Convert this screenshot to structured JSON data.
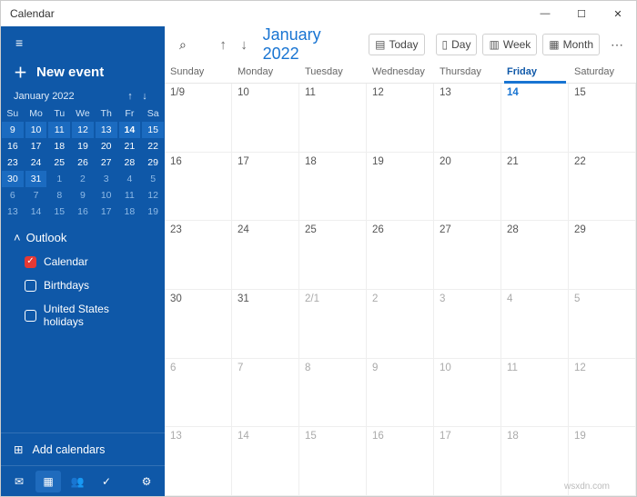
{
  "window": {
    "title": "Calendar"
  },
  "win_controls": {
    "min": "—",
    "max": "☐",
    "close": "✕"
  },
  "sidebar": {
    "hamburger": "≡",
    "new_event": {
      "icon": "＋",
      "label": "New event"
    },
    "mini": {
      "label": "January 2022",
      "up": "↑",
      "down": "↓",
      "dow": [
        "Su",
        "Mo",
        "Tu",
        "We",
        "Th",
        "Fr",
        "Sa"
      ],
      "weeks": [
        [
          {
            "d": "9",
            "c": "selmonth cw"
          },
          {
            "d": "10",
            "c": "selmonth cw"
          },
          {
            "d": "11",
            "c": "selmonth cw"
          },
          {
            "d": "12",
            "c": "selmonth cw"
          },
          {
            "d": "13",
            "c": "selmonth cw"
          },
          {
            "d": "14",
            "c": "selmonth cw today"
          },
          {
            "d": "15",
            "c": "selmonth cw"
          }
        ],
        [
          {
            "d": "16",
            "c": "selmonth"
          },
          {
            "d": "17",
            "c": "selmonth"
          },
          {
            "d": "18",
            "c": "selmonth"
          },
          {
            "d": "19",
            "c": "selmonth"
          },
          {
            "d": "20",
            "c": "selmonth"
          },
          {
            "d": "21",
            "c": "selmonth"
          },
          {
            "d": "22",
            "c": "selmonth"
          }
        ],
        [
          {
            "d": "23",
            "c": "selmonth"
          },
          {
            "d": "24",
            "c": "selmonth"
          },
          {
            "d": "25",
            "c": "selmonth"
          },
          {
            "d": "26",
            "c": "selmonth"
          },
          {
            "d": "27",
            "c": "selmonth"
          },
          {
            "d": "28",
            "c": "selmonth"
          },
          {
            "d": "29",
            "c": "selmonth"
          }
        ],
        [
          {
            "d": "30",
            "c": "selmonth end"
          },
          {
            "d": "31",
            "c": "selmonth end"
          },
          {
            "d": "1",
            "c": "fade"
          },
          {
            "d": "2",
            "c": "fade"
          },
          {
            "d": "3",
            "c": "fade"
          },
          {
            "d": "4",
            "c": "fade"
          },
          {
            "d": "5",
            "c": "fade"
          }
        ],
        [
          {
            "d": "6",
            "c": "fade"
          },
          {
            "d": "7",
            "c": "fade"
          },
          {
            "d": "8",
            "c": "fade"
          },
          {
            "d": "9",
            "c": "fade"
          },
          {
            "d": "10",
            "c": "fade"
          },
          {
            "d": "11",
            "c": "fade"
          },
          {
            "d": "12",
            "c": "fade"
          }
        ],
        [
          {
            "d": "13",
            "c": "fade"
          },
          {
            "d": "14",
            "c": "fade"
          },
          {
            "d": "15",
            "c": "fade"
          },
          {
            "d": "16",
            "c": "fade"
          },
          {
            "d": "17",
            "c": "fade"
          },
          {
            "d": "18",
            "c": "fade"
          },
          {
            "d": "19",
            "c": "fade"
          }
        ]
      ]
    },
    "accounts": {
      "caret": "˄",
      "label": "Outlook",
      "items": [
        {
          "label": "Calendar",
          "checked": true
        },
        {
          "label": "Birthdays",
          "checked": false
        },
        {
          "label": "United States holidays",
          "checked": false
        }
      ]
    },
    "add_cals": {
      "icon": "⊞",
      "label": "Add calendars"
    },
    "bottom_icons": {
      "mail": "✉",
      "calendar": "▦",
      "people": "👥",
      "todo": "✓",
      "settings": "⚙"
    }
  },
  "toolbar": {
    "search": "⌕",
    "up": "↑",
    "down": "↓",
    "current": "January 2022",
    "today": {
      "icon": "▤",
      "label": "Today"
    },
    "day": {
      "icon": "▯",
      "label": "Day"
    },
    "week": {
      "icon": "▥",
      "label": "Week"
    },
    "month": {
      "icon": "▦",
      "label": "Month"
    },
    "more": "⋯"
  },
  "headers": [
    "Sunday",
    "Monday",
    "Tuesday",
    "Wednesday",
    "Thursday",
    "Friday",
    "Saturday"
  ],
  "today_index": 5,
  "grid": [
    [
      {
        "t": "1/9"
      },
      {
        "t": "10"
      },
      {
        "t": "11"
      },
      {
        "t": "12"
      },
      {
        "t": "13"
      },
      {
        "t": "14",
        "today": true
      },
      {
        "t": "15"
      }
    ],
    [
      {
        "t": "16"
      },
      {
        "t": "17"
      },
      {
        "t": "18"
      },
      {
        "t": "19"
      },
      {
        "t": "20"
      },
      {
        "t": "21"
      },
      {
        "t": "22"
      }
    ],
    [
      {
        "t": "23"
      },
      {
        "t": "24"
      },
      {
        "t": "25"
      },
      {
        "t": "26"
      },
      {
        "t": "27"
      },
      {
        "t": "28"
      },
      {
        "t": "29"
      }
    ],
    [
      {
        "t": "30"
      },
      {
        "t": "31"
      },
      {
        "t": "2/1",
        "off": true
      },
      {
        "t": "2",
        "off": true
      },
      {
        "t": "3",
        "off": true
      },
      {
        "t": "4",
        "off": true
      },
      {
        "t": "5",
        "off": true
      }
    ],
    [
      {
        "t": "6",
        "off": true
      },
      {
        "t": "7",
        "off": true
      },
      {
        "t": "8",
        "off": true
      },
      {
        "t": "9",
        "off": true
      },
      {
        "t": "10",
        "off": true
      },
      {
        "t": "11",
        "off": true
      },
      {
        "t": "12",
        "off": true
      }
    ],
    [
      {
        "t": "13",
        "off": true
      },
      {
        "t": "14",
        "off": true
      },
      {
        "t": "15",
        "off": true
      },
      {
        "t": "16",
        "off": true
      },
      {
        "t": "17",
        "off": true
      },
      {
        "t": "18",
        "off": true
      },
      {
        "t": "19",
        "off": true
      }
    ]
  ],
  "watermark": "wsxdn.com"
}
